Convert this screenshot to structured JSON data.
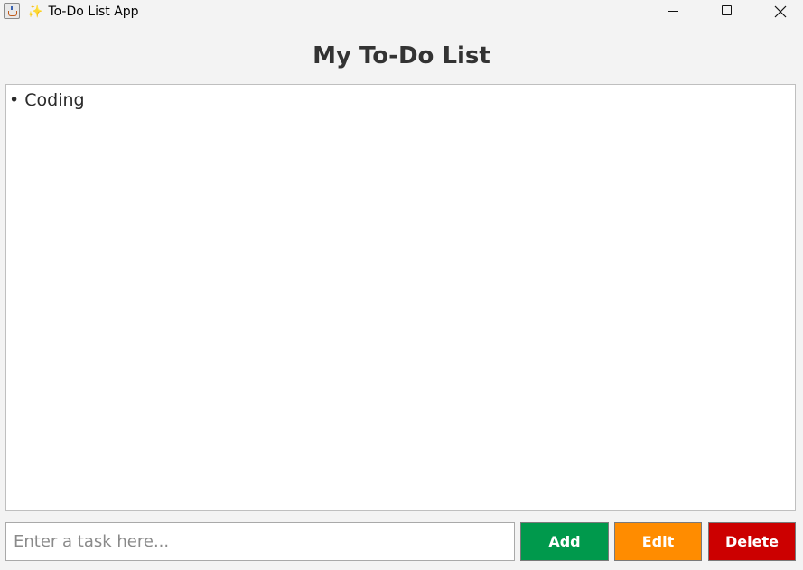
{
  "window": {
    "title_icon": "sparkle",
    "title": "To-Do List App"
  },
  "heading": "My To-Do List",
  "tasks": [
    {
      "label": "• Coding"
    }
  ],
  "input": {
    "value": "",
    "placeholder": "Enter a task here..."
  },
  "buttons": {
    "add": {
      "label": "Add",
      "color": "#00994c"
    },
    "edit": {
      "label": "Edit",
      "color": "#ff8c00"
    },
    "delete": {
      "label": "Delete",
      "color": "#cc0000"
    }
  },
  "icons": {
    "app": "java-app-icon",
    "sparkle": "sparkle-icon",
    "minimize": "minimize-icon",
    "maximize": "maximize-icon",
    "close": "close-icon"
  }
}
